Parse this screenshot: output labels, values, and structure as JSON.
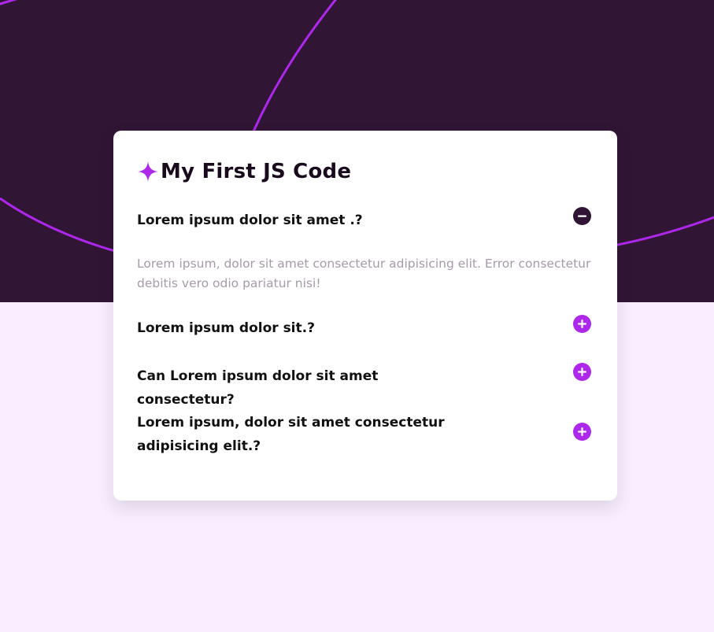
{
  "page": {
    "title": "My First JS Code",
    "title_icon": "star-icon",
    "colors": {
      "dark_purple": "#301534",
      "accent_purple": "#ad28eb",
      "page_background": "#f8eeff",
      "card_background": "#ffffff",
      "answer_text": "#a59aa8"
    }
  },
  "faq": [
    {
      "question": "Lorem ipsum dolor sit amet .?",
      "answer": "Lorem ipsum, dolor sit amet consectetur adipisicing elit. Error consectetur debitis vero odio pariatur nisi!",
      "expanded": true,
      "toggle_icon": "minus-circle-icon"
    },
    {
      "question": "Lorem ipsum dolor sit.?",
      "expanded": false,
      "toggle_icon": "plus-circle-icon"
    },
    {
      "question": "Can Lorem ipsum dolor sit amet consectetur?",
      "expanded": false,
      "toggle_icon": "plus-circle-icon"
    },
    {
      "question": "Lorem ipsum, dolor sit amet consectetur adipisicing elit.?",
      "expanded": false,
      "toggle_icon": "plus-circle-icon"
    }
  ]
}
